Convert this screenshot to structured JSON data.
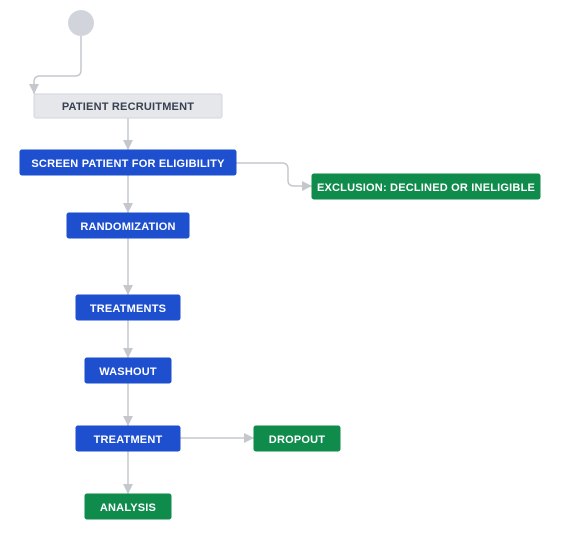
{
  "flow": {
    "nodes": {
      "recruitment": "PATIENT RECRUITMENT",
      "screen": "SCREEN PATIENT FOR ELIGIBILITY",
      "exclusion": "EXCLUSION: DECLINED OR INELIGIBLE",
      "randomization": "RANDOMIZATION",
      "treatments": "TREATMENTS",
      "washout": "WASHOUT",
      "treatment2": "TREATMENT",
      "dropout": "DROPOUT",
      "analysis": "ANALYSIS"
    }
  }
}
